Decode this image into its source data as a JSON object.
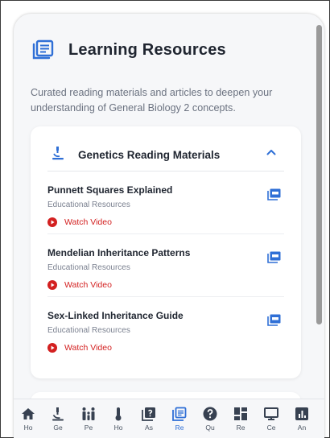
{
  "header": {
    "title": "Learning Resources",
    "icon": "book-list-icon"
  },
  "intro": "Curated reading materials and articles to deepen your understanding of General Biology 2 concepts.",
  "section": {
    "title": "Genetics Reading Materials",
    "icon": "microscope-icon",
    "expanded": true,
    "items": [
      {
        "title": "Punnett Squares Explained",
        "subtitle": "Educational Resources",
        "action": "Watch Video"
      },
      {
        "title": "Mendelian Inheritance Patterns",
        "subtitle": "Educational Resources",
        "action": "Watch Video"
      },
      {
        "title": "Sex-Linked Inheritance Guide",
        "subtitle": "Educational Resources",
        "action": "Watch Video"
      }
    ]
  },
  "nav": {
    "items": [
      {
        "label": "Ho",
        "icon": "home-icon"
      },
      {
        "label": "Ge",
        "icon": "microscope-icon"
      },
      {
        "label": "Pe",
        "icon": "family-icon"
      },
      {
        "label": "Ho",
        "icon": "thermometer-icon"
      },
      {
        "label": "As",
        "icon": "quiz-icon"
      },
      {
        "label": "Re",
        "icon": "book-list-icon",
        "active": true
      },
      {
        "label": "Qu",
        "icon": "help-icon"
      },
      {
        "label": "Re",
        "icon": "dashboard-icon"
      },
      {
        "label": "Ce",
        "icon": "monitor-icon"
      },
      {
        "label": "An",
        "icon": "analytics-icon"
      }
    ]
  },
  "colors": {
    "accent": "#2f6fd6",
    "title": "#1f2530",
    "muted": "#6b7280",
    "video_red": "#d32020",
    "background": "#f6f7f9"
  }
}
